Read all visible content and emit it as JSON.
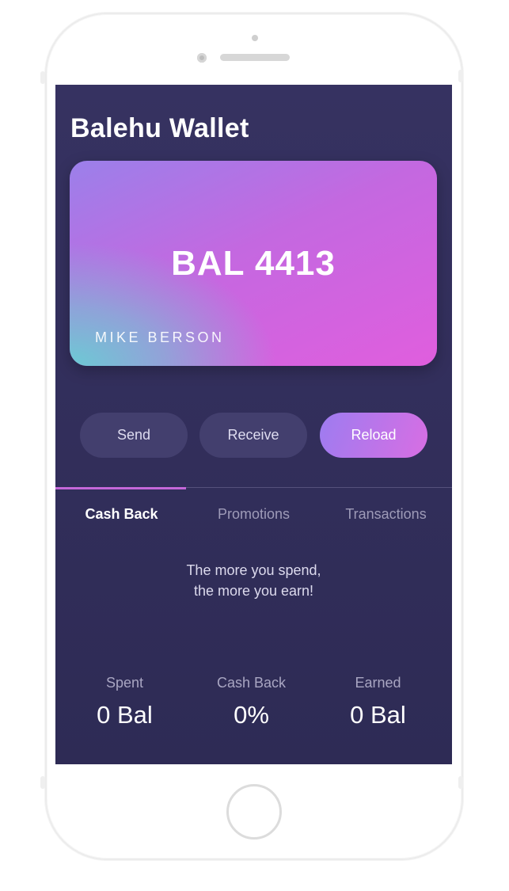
{
  "app": {
    "title": "Balehu Wallet"
  },
  "card": {
    "balance": "BAL 4413",
    "holder": "MIKE BERSON"
  },
  "actions": {
    "send": "Send",
    "receive": "Receive",
    "reload": "Reload"
  },
  "tabs": [
    {
      "label": "Cash Back",
      "active": true
    },
    {
      "label": "Promotions",
      "active": false
    },
    {
      "label": "Transactions",
      "active": false
    }
  ],
  "cashback": {
    "message_line1": "The more you spend,",
    "message_line2": "the more you earn!",
    "stats": [
      {
        "label": "Spent",
        "value": "0 Bal"
      },
      {
        "label": "Cash Back",
        "value": "0%"
      },
      {
        "label": "Earned",
        "value": "0 Bal"
      }
    ]
  },
  "colors": {
    "screen_bg": "#363261",
    "accent": "#c467d9",
    "card_gradient": [
      "#9b80ea",
      "#e05ede",
      "#6ccad4"
    ]
  }
}
